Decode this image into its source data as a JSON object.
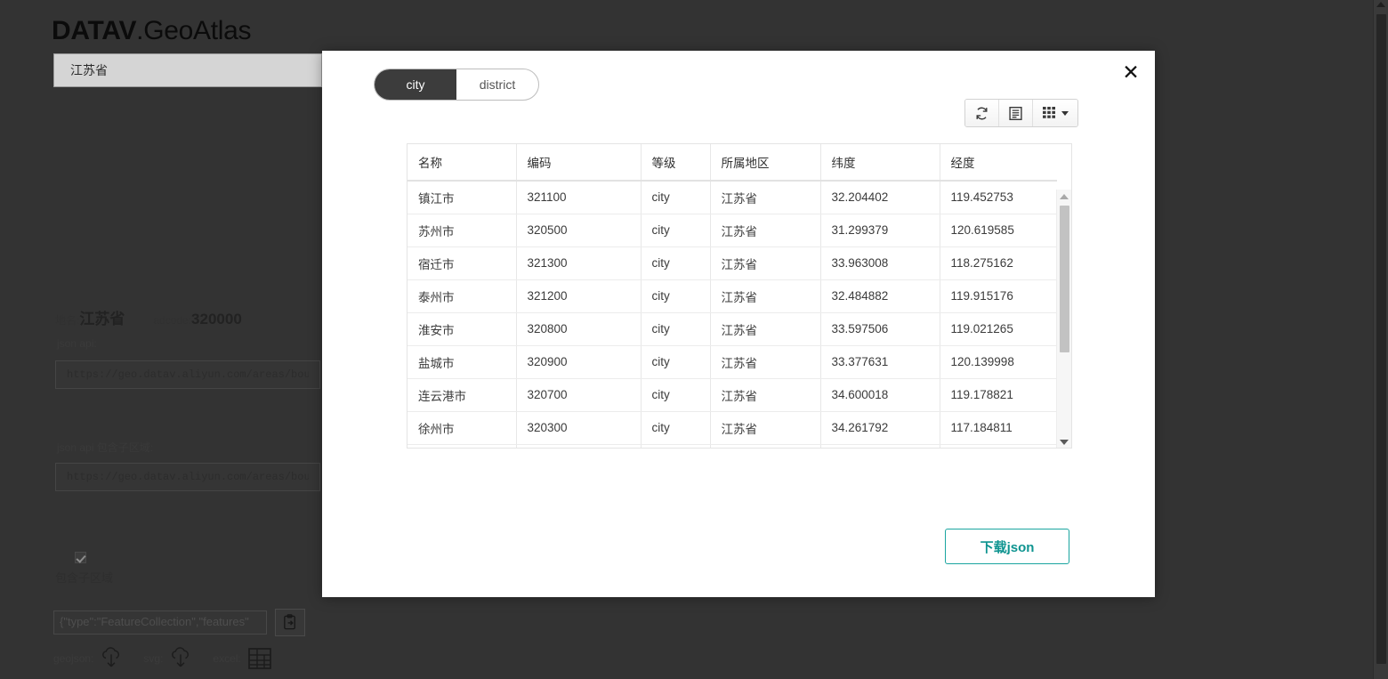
{
  "brand": {
    "strong": "DATAV",
    "light": ".GeoAtlas"
  },
  "search": {
    "value": "江苏省",
    "placeholder": ""
  },
  "info": {
    "name_label": "地名:",
    "name_value": "江苏省",
    "adcode_label": "adcode:",
    "adcode_value": "320000"
  },
  "api": {
    "json_label": "json api:",
    "json_value": "https://geo.datav.aliyun.com/areas/bound",
    "json_sub_label": "json api 包含子区域:",
    "json_sub_value": "https://geo.datav.aliyun.com/areas/bound"
  },
  "options": {
    "include_sub_label": "包含子区域",
    "include_sub_checked": true
  },
  "geojson_box": {
    "value": "{\"type\":\"FeatureCollection\",\"features\"",
    "copy_icon": "clipboard-copy-icon"
  },
  "downloads": [
    {
      "label": "geojson:",
      "icon": "cloud-download-icon"
    },
    {
      "label": "svg:",
      "icon": "cloud-download-icon"
    },
    {
      "label": "excel:",
      "icon": "table-grid-icon"
    }
  ],
  "modal": {
    "close_label": "✕",
    "tabs": [
      {
        "label": "city",
        "active": true
      },
      {
        "label": "district",
        "active": false
      }
    ],
    "toolbar": [
      {
        "name": "refresh-button",
        "icon": "refresh-icon"
      },
      {
        "name": "detail-view-button",
        "icon": "list-detail-icon"
      },
      {
        "name": "columns-button",
        "icon": "columns-grid-icon",
        "caret": true
      }
    ],
    "download_button": "下载json"
  },
  "table": {
    "headers": [
      "名称",
      "编码",
      "等级",
      "所属地区",
      "纬度",
      "经度"
    ],
    "rows": [
      [
        "镇江市",
        "321100",
        "city",
        "江苏省",
        "32.204402",
        "119.452753"
      ],
      [
        "苏州市",
        "320500",
        "city",
        "江苏省",
        "31.299379",
        "120.619585"
      ],
      [
        "宿迁市",
        "321300",
        "city",
        "江苏省",
        "33.963008",
        "118.275162"
      ],
      [
        "泰州市",
        "321200",
        "city",
        "江苏省",
        "32.484882",
        "119.915176"
      ],
      [
        "淮安市",
        "320800",
        "city",
        "江苏省",
        "33.597506",
        "119.021265"
      ],
      [
        "盐城市",
        "320900",
        "city",
        "江苏省",
        "33.377631",
        "120.139998"
      ],
      [
        "连云港市",
        "320700",
        "city",
        "江苏省",
        "34.600018",
        "119.178821"
      ],
      [
        "徐州市",
        "320300",
        "city",
        "江苏省",
        "34.261792",
        "117.184811"
      ]
    ]
  },
  "colors": {
    "page_bg": "#333333",
    "accent_teal": "#0e9490",
    "tab_active_bg": "#3c3c3c",
    "search_bg": "#d5d5d5"
  }
}
